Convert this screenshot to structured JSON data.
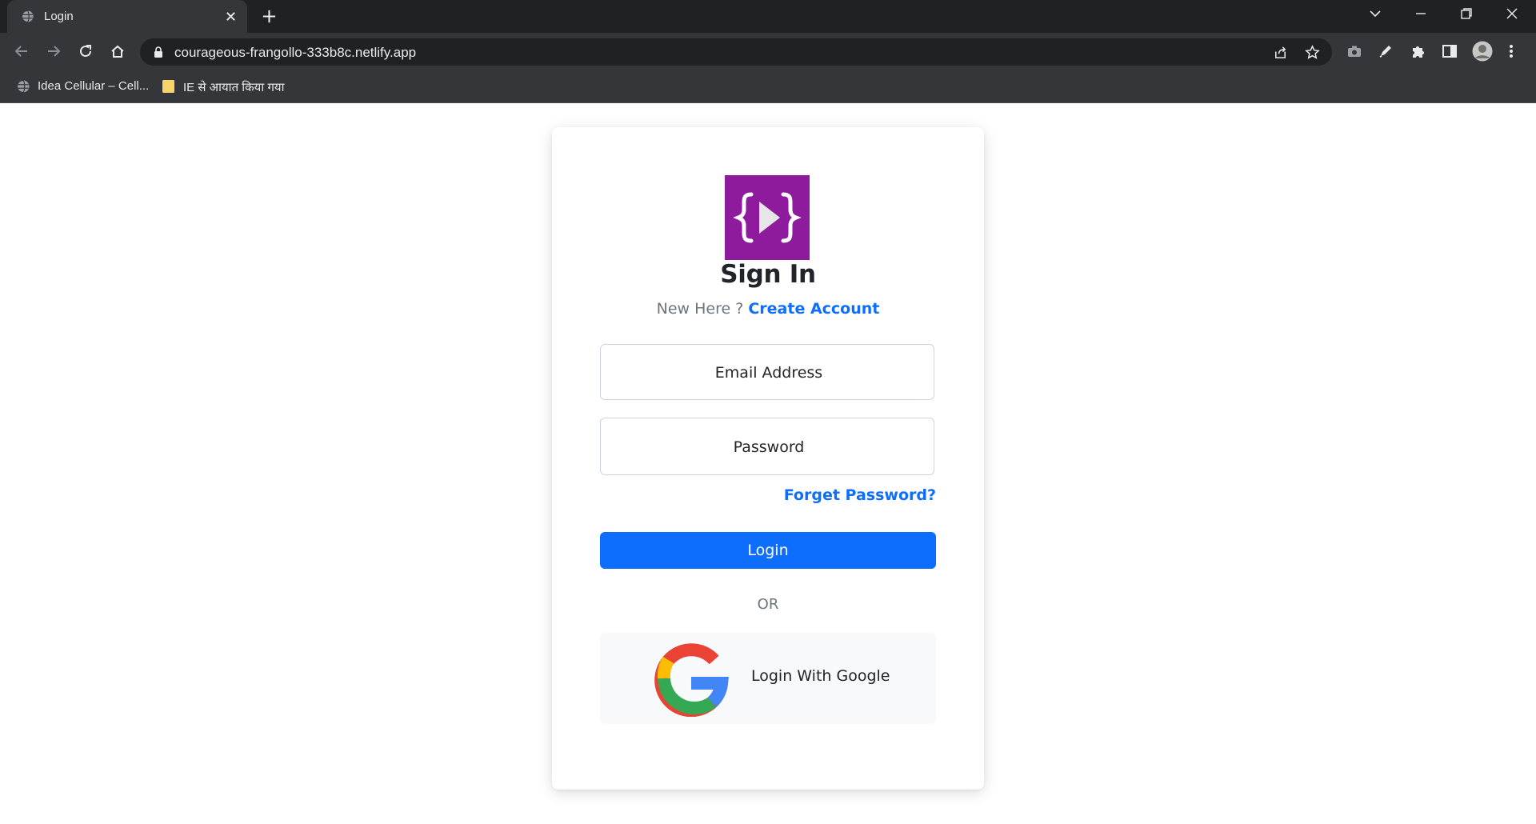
{
  "browser": {
    "tab_title": "Login",
    "url": "courageous-frangollo-333b8c.netlify.app",
    "bookmarks": [
      {
        "label": "Idea Cellular – Cell...",
        "icon": "globe-icon"
      },
      {
        "label": "IE से आयात किया गया",
        "icon": "folder-icon"
      }
    ],
    "colors": {
      "chrome_dark": "#202124",
      "chrome_mid": "#35363a",
      "text": "#e8eaed"
    }
  },
  "page": {
    "heading": "Sign In",
    "new_here": "New Here ? ",
    "create_account": "Create Account",
    "email_placeholder": "Email Address",
    "password_placeholder": "Password",
    "forgot_password": "Forget Password?",
    "login_button": "Login",
    "or_text": "OR",
    "google_button": "Login With Google",
    "colors": {
      "logo": "#8e1a9e",
      "primary": "#0d6efd",
      "muted": "#6c757d"
    }
  }
}
